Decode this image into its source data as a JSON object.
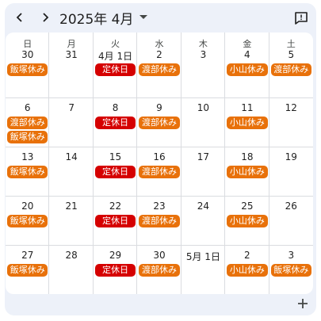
{
  "header": {
    "title": "2025年 4月",
    "prev_icon": "chevron-left-icon",
    "next_icon": "chevron-right-icon",
    "dropdown_icon": "caret-down-icon",
    "feedback_icon": "feedback-icon"
  },
  "weekdays": [
    "日",
    "月",
    "火",
    "水",
    "木",
    "金",
    "土"
  ],
  "colors": {
    "orange": "#e8710a",
    "red": "#d50000",
    "panel_bg": "#edf1f9",
    "grid_line": "#dadce0"
  },
  "weeks": [
    [
      {
        "date": "30",
        "events": [
          {
            "label": "飯塚休み",
            "color": "orange"
          }
        ]
      },
      {
        "date": "31",
        "events": []
      },
      {
        "date": "4月 1日",
        "events": [
          {
            "label": "定休日",
            "color": "red"
          }
        ]
      },
      {
        "date": "2",
        "events": [
          {
            "label": "渡部休み",
            "color": "orange"
          }
        ]
      },
      {
        "date": "3",
        "events": []
      },
      {
        "date": "4",
        "events": [
          {
            "label": "小山休み",
            "color": "orange"
          }
        ]
      },
      {
        "date": "5",
        "events": [
          {
            "label": "渡部休み",
            "color": "orange"
          }
        ]
      }
    ],
    [
      {
        "date": "6",
        "events": [
          {
            "label": "渡部休み",
            "color": "orange"
          },
          {
            "label": "飯塚休み",
            "color": "orange"
          }
        ]
      },
      {
        "date": "7",
        "events": []
      },
      {
        "date": "8",
        "events": [
          {
            "label": "定休日",
            "color": "red"
          }
        ]
      },
      {
        "date": "9",
        "events": [
          {
            "label": "渡部休み",
            "color": "orange"
          }
        ]
      },
      {
        "date": "10",
        "events": []
      },
      {
        "date": "11",
        "events": [
          {
            "label": "小山休み",
            "color": "orange"
          }
        ]
      },
      {
        "date": "12",
        "events": []
      }
    ],
    [
      {
        "date": "13",
        "events": [
          {
            "label": "飯塚休み",
            "color": "orange"
          }
        ]
      },
      {
        "date": "14",
        "events": []
      },
      {
        "date": "15",
        "events": [
          {
            "label": "定休日",
            "color": "red"
          }
        ]
      },
      {
        "date": "16",
        "events": [
          {
            "label": "渡部休み",
            "color": "orange"
          }
        ]
      },
      {
        "date": "17",
        "events": []
      },
      {
        "date": "18",
        "events": [
          {
            "label": "小山休み",
            "color": "orange"
          }
        ]
      },
      {
        "date": "19",
        "events": []
      }
    ],
    [
      {
        "date": "20",
        "events": [
          {
            "label": "飯塚休み",
            "color": "orange"
          }
        ]
      },
      {
        "date": "21",
        "events": []
      },
      {
        "date": "22",
        "events": [
          {
            "label": "定休日",
            "color": "red"
          }
        ]
      },
      {
        "date": "23",
        "events": [
          {
            "label": "渡部休み",
            "color": "orange"
          }
        ]
      },
      {
        "date": "24",
        "events": []
      },
      {
        "date": "25",
        "events": [
          {
            "label": "小山休み",
            "color": "orange"
          }
        ]
      },
      {
        "date": "26",
        "events": []
      }
    ],
    [
      {
        "date": "27",
        "events": [
          {
            "label": "飯塚休み",
            "color": "orange"
          }
        ]
      },
      {
        "date": "28",
        "events": []
      },
      {
        "date": "29",
        "events": [
          {
            "label": "定休日",
            "color": "red"
          }
        ]
      },
      {
        "date": "30",
        "events": [
          {
            "label": "渡部休み",
            "color": "orange"
          }
        ]
      },
      {
        "date": "5月 1日",
        "events": []
      },
      {
        "date": "2",
        "events": [
          {
            "label": "小山休み",
            "color": "orange"
          }
        ]
      },
      {
        "date": "3",
        "events": [
          {
            "label": "飯塚休み",
            "color": "orange"
          }
        ]
      }
    ]
  ],
  "fab_icon": "plus-icon"
}
